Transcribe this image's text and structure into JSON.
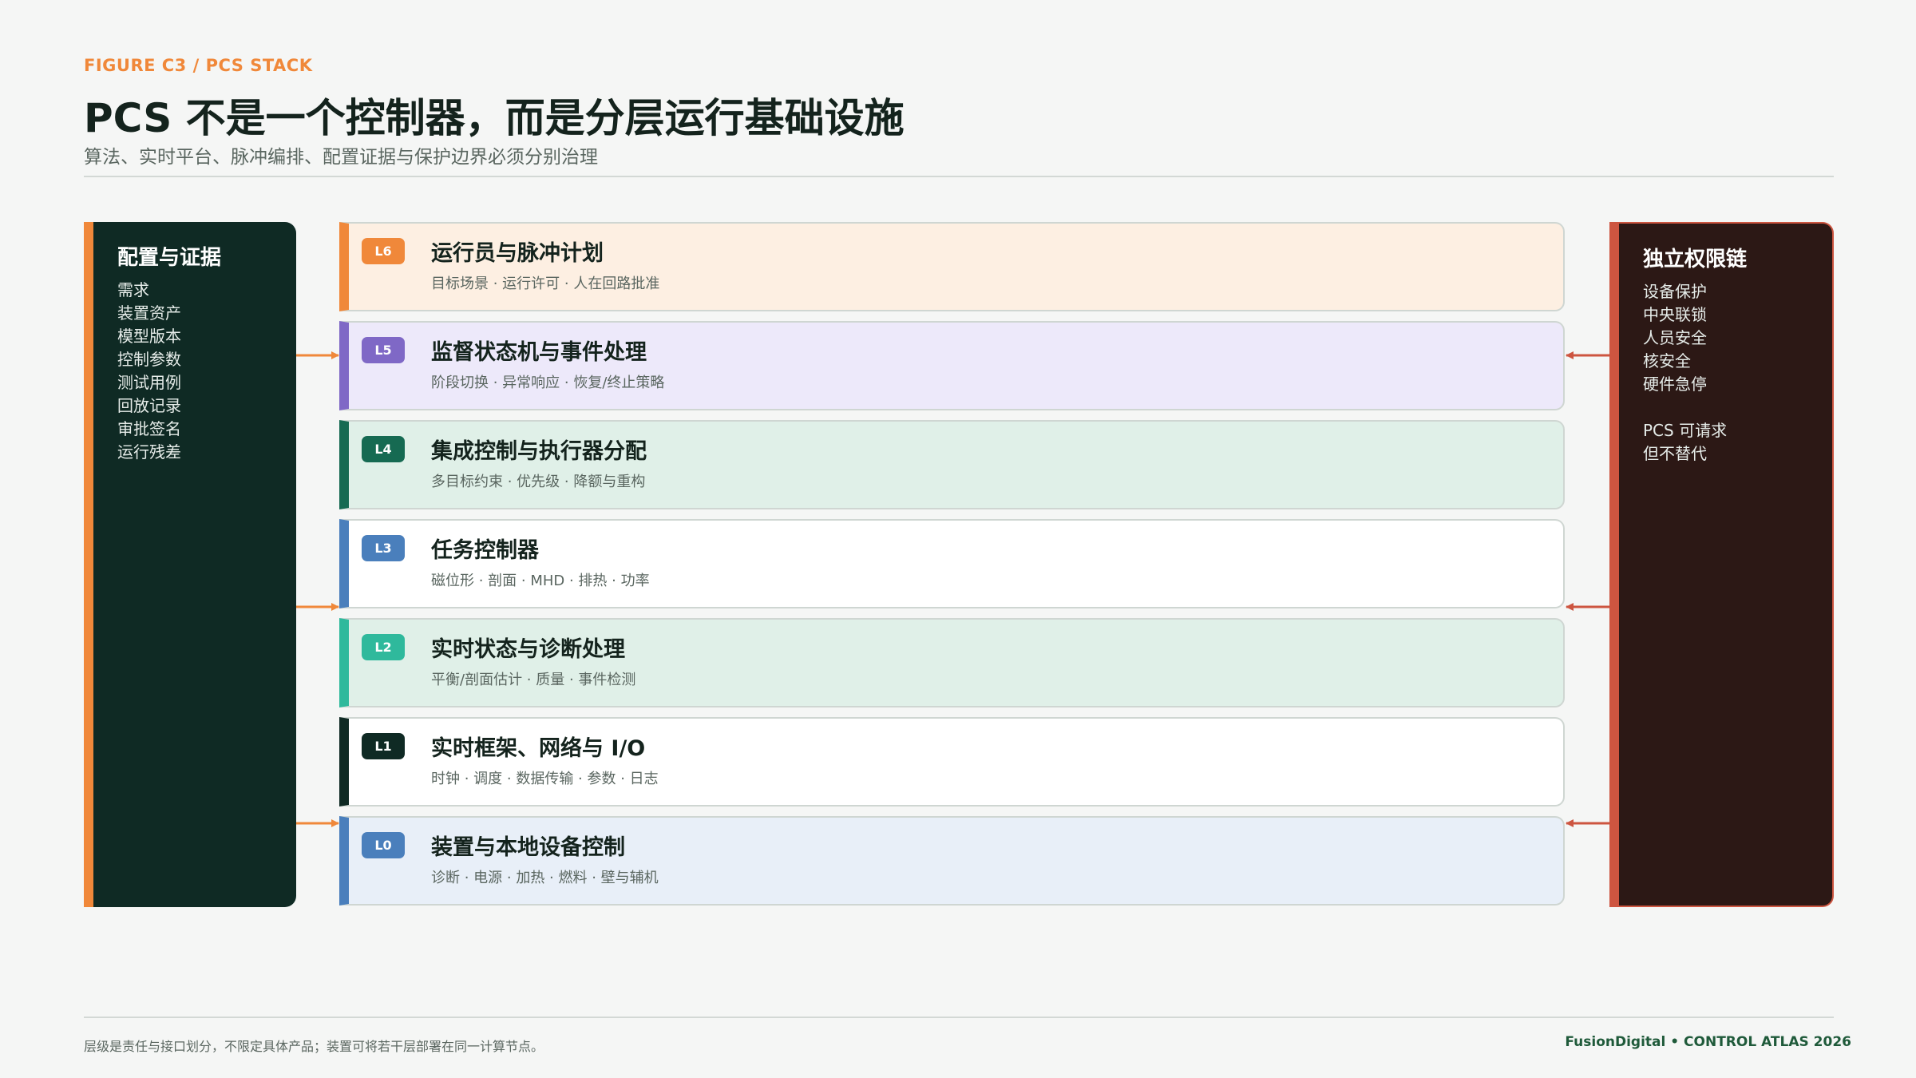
{
  "header": {
    "figure_label": "FIGURE C3 / PCS STACK",
    "title": "PCS 不是一个控制器，而是分层运行基础设施",
    "subtitle": "算法、实时平台、脉冲编排、配置证据与保护边界必须分别治理"
  },
  "left_panel": {
    "title": "配置与证据",
    "items": [
      "需求",
      "装置资产",
      "模型版本",
      "控制参数",
      "测试用例",
      "回放记录",
      "审批签名",
      "运行残差"
    ]
  },
  "right_panel": {
    "title": "独立权限链",
    "items": [
      "设备保护",
      "中央联锁",
      "人员安全",
      "核安全",
      "硬件急停"
    ],
    "note": [
      "PCS 可请求",
      "但不替代"
    ]
  },
  "layers": [
    {
      "badge": "L6",
      "name": "运行员与脉冲计划",
      "desc": "目标场景 · 运行许可 · 人在回路批准",
      "accent": "#f0883a",
      "bg": "#fdefe2"
    },
    {
      "badge": "L5",
      "name": "监督状态机与事件处理",
      "desc": "阶段切换 · 异常响应 · 恢复/终止策略",
      "accent": "#7f68c6",
      "bg": "#ede9fa"
    },
    {
      "badge": "L4",
      "name": "集成控制与执行器分配",
      "desc": "多目标约束 · 优先级 · 降额与重构",
      "accent": "#166a52",
      "bg": "#e0f0e8"
    },
    {
      "badge": "L3",
      "name": "任务控制器",
      "desc": "磁位形 · 剖面 · MHD · 排热 · 功率",
      "accent": "#4a7fbc",
      "bg": "#ffffff"
    },
    {
      "badge": "L2",
      "name": "实时状态与诊断处理",
      "desc": "平衡/剖面估计 · 质量 · 事件检测",
      "accent": "#2fb99c",
      "bg": "#e0f0e8"
    },
    {
      "badge": "L1",
      "name": "实时框架、网络与 I/O",
      "desc": "时钟 · 调度 · 数据传输 · 参数 · 日志",
      "accent": "#0f2a24",
      "bg": "#ffffff"
    },
    {
      "badge": "L0",
      "name": "装置与本地设备控制",
      "desc": "诊断 · 电源 · 加热 · 燃料 · 壁与辅机",
      "accent": "#4a7fbc",
      "bg": "#e8eff8"
    }
  ],
  "colors": {
    "left_arrow": "#f0883a",
    "right_arrow": "#cd5540"
  },
  "footer": {
    "note": "层级是责任与接口划分，不限定具体产品；装置可将若干层部署在同一计算节点。",
    "brand": "FusionDigital • CONTROL ATLAS 2026"
  }
}
